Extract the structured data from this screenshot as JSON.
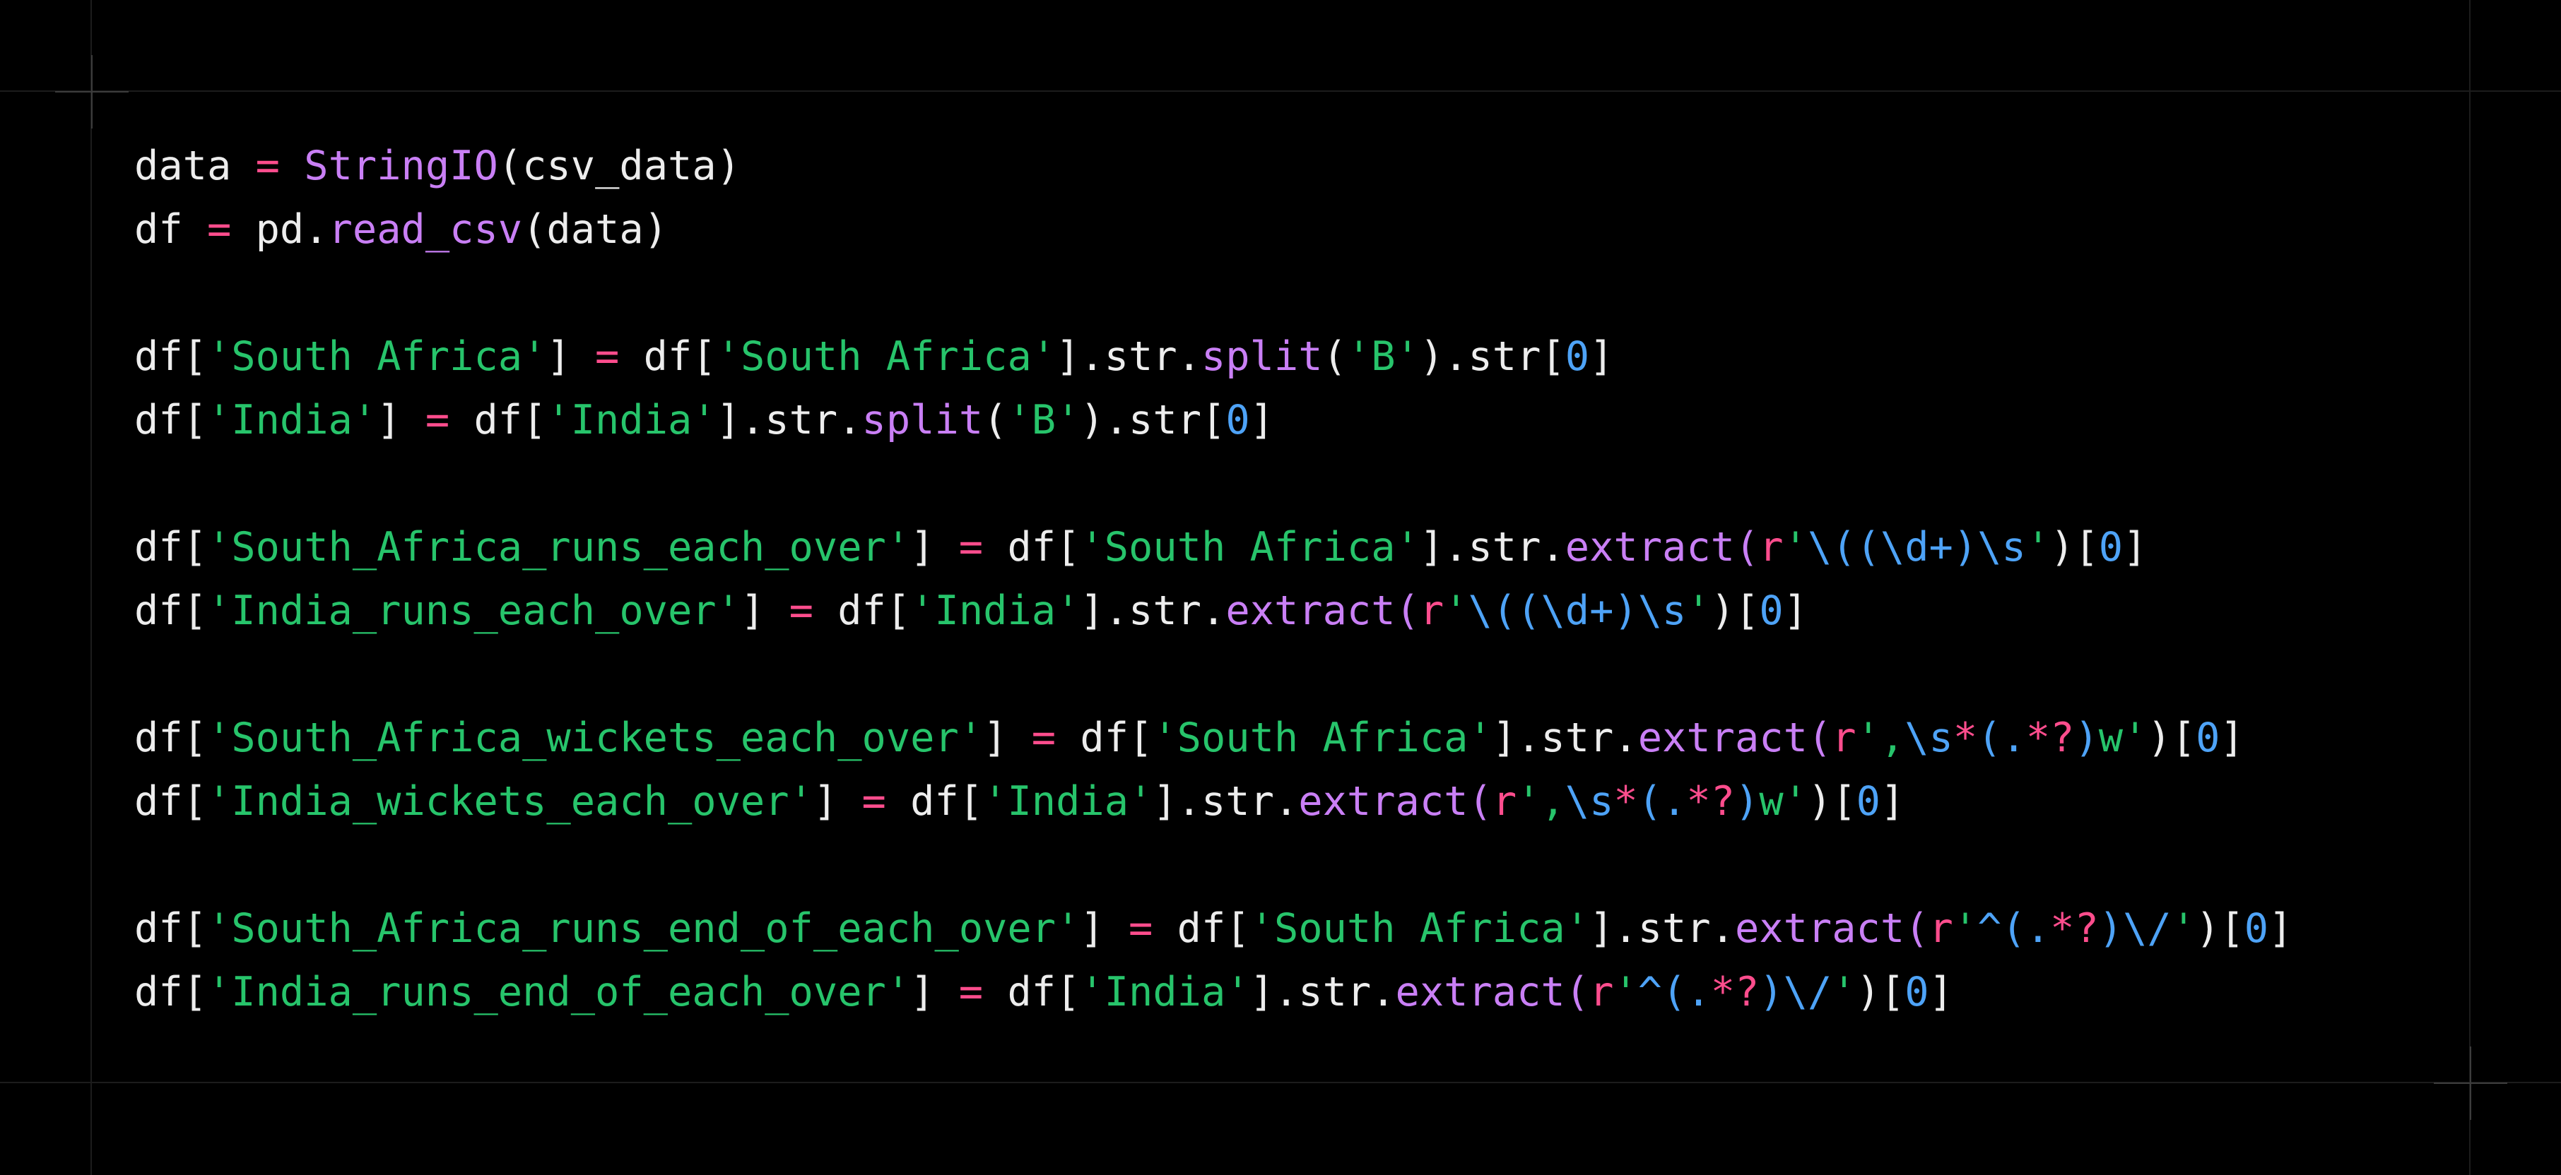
{
  "colors": {
    "background": "#000000",
    "text": "#ededed",
    "operator": "#ff4d8d",
    "function": "#c97ff5",
    "string": "#27c46b",
    "number": "#4ea3f7",
    "regex_escape": "#4ea3f7"
  },
  "code_lines": [
    {
      "tokens": [
        {
          "t": "data ",
          "k": "plain"
        },
        {
          "t": "=",
          "k": "op"
        },
        {
          "t": " ",
          "k": "plain"
        },
        {
          "t": "StringIO",
          "k": "fn"
        },
        {
          "t": "(csv_data)",
          "k": "plain"
        }
      ]
    },
    {
      "tokens": [
        {
          "t": "df ",
          "k": "plain"
        },
        {
          "t": "=",
          "k": "op"
        },
        {
          "t": " pd.",
          "k": "plain"
        },
        {
          "t": "read_csv",
          "k": "fn"
        },
        {
          "t": "(data)",
          "k": "plain"
        }
      ]
    },
    {
      "blank": true
    },
    {
      "tokens": [
        {
          "t": "df[",
          "k": "plain"
        },
        {
          "t": "'South Africa'",
          "k": "str"
        },
        {
          "t": "] ",
          "k": "plain"
        },
        {
          "t": "=",
          "k": "op"
        },
        {
          "t": " df[",
          "k": "plain"
        },
        {
          "t": "'South Africa'",
          "k": "str"
        },
        {
          "t": "].str.",
          "k": "plain"
        },
        {
          "t": "split",
          "k": "fn"
        },
        {
          "t": "(",
          "k": "plain"
        },
        {
          "t": "'B'",
          "k": "str"
        },
        {
          "t": ").str[",
          "k": "plain"
        },
        {
          "t": "0",
          "k": "num"
        },
        {
          "t": "]",
          "k": "plain"
        }
      ]
    },
    {
      "tokens": [
        {
          "t": "df[",
          "k": "plain"
        },
        {
          "t": "'India'",
          "k": "str"
        },
        {
          "t": "] ",
          "k": "plain"
        },
        {
          "t": "=",
          "k": "op"
        },
        {
          "t": " df[",
          "k": "plain"
        },
        {
          "t": "'India'",
          "k": "str"
        },
        {
          "t": "].str.",
          "k": "plain"
        },
        {
          "t": "split",
          "k": "fn"
        },
        {
          "t": "(",
          "k": "plain"
        },
        {
          "t": "'B'",
          "k": "str"
        },
        {
          "t": ").str[",
          "k": "plain"
        },
        {
          "t": "0",
          "k": "num"
        },
        {
          "t": "]",
          "k": "plain"
        }
      ]
    },
    {
      "blank": true
    },
    {
      "tokens": [
        {
          "t": "df[",
          "k": "plain"
        },
        {
          "t": "'South_Africa_runs_each_over'",
          "k": "str"
        },
        {
          "t": "] ",
          "k": "plain"
        },
        {
          "t": "=",
          "k": "op"
        },
        {
          "t": " df[",
          "k": "plain"
        },
        {
          "t": "'South Africa'",
          "k": "str"
        },
        {
          "t": "].str.",
          "k": "plain"
        },
        {
          "t": "extract",
          "k": "fn"
        },
        {
          "t": "(",
          "k": "fn"
        },
        {
          "t": "r",
          "k": "rpre"
        },
        {
          "t": "'",
          "k": "str"
        },
        {
          "t": "\\((\\d+)\\s",
          "k": "esc"
        },
        {
          "t": "'",
          "k": "str"
        },
        {
          "t": ")[",
          "k": "plain"
        },
        {
          "t": "0",
          "k": "num"
        },
        {
          "t": "]",
          "k": "plain"
        }
      ]
    },
    {
      "tokens": [
        {
          "t": "df[",
          "k": "plain"
        },
        {
          "t": "'India_runs_each_over'",
          "k": "str"
        },
        {
          "t": "] ",
          "k": "plain"
        },
        {
          "t": "=",
          "k": "op"
        },
        {
          "t": " df[",
          "k": "plain"
        },
        {
          "t": "'India'",
          "k": "str"
        },
        {
          "t": "].str.",
          "k": "plain"
        },
        {
          "t": "extract",
          "k": "fn"
        },
        {
          "t": "(",
          "k": "fn"
        },
        {
          "t": "r",
          "k": "rpre"
        },
        {
          "t": "'",
          "k": "str"
        },
        {
          "t": "\\((\\d+)\\s",
          "k": "esc"
        },
        {
          "t": "'",
          "k": "str"
        },
        {
          "t": ")[",
          "k": "plain"
        },
        {
          "t": "0",
          "k": "num"
        },
        {
          "t": "]",
          "k": "plain"
        }
      ]
    },
    {
      "blank": true
    },
    {
      "tokens": [
        {
          "t": "df[",
          "k": "plain"
        },
        {
          "t": "'South_Africa_wickets_each_over'",
          "k": "str"
        },
        {
          "t": "] ",
          "k": "plain"
        },
        {
          "t": "=",
          "k": "op"
        },
        {
          "t": " df[",
          "k": "plain"
        },
        {
          "t": "'South Africa'",
          "k": "str"
        },
        {
          "t": "].str.",
          "k": "plain"
        },
        {
          "t": "extract",
          "k": "fn"
        },
        {
          "t": "(",
          "k": "fn"
        },
        {
          "t": "r",
          "k": "rpre"
        },
        {
          "t": "',",
          "k": "str"
        },
        {
          "t": "\\s",
          "k": "esc"
        },
        {
          "t": "*",
          "k": "op"
        },
        {
          "t": "(.",
          "k": "esc"
        },
        {
          "t": "*?",
          "k": "op"
        },
        {
          "t": ")",
          "k": "esc"
        },
        {
          "t": "w'",
          "k": "str"
        },
        {
          "t": ")[",
          "k": "plain"
        },
        {
          "t": "0",
          "k": "num"
        },
        {
          "t": "]",
          "k": "plain"
        }
      ]
    },
    {
      "tokens": [
        {
          "t": "df[",
          "k": "plain"
        },
        {
          "t": "'India_wickets_each_over'",
          "k": "str"
        },
        {
          "t": "] ",
          "k": "plain"
        },
        {
          "t": "=",
          "k": "op"
        },
        {
          "t": " df[",
          "k": "plain"
        },
        {
          "t": "'India'",
          "k": "str"
        },
        {
          "t": "].str.",
          "k": "plain"
        },
        {
          "t": "extract",
          "k": "fn"
        },
        {
          "t": "(",
          "k": "fn"
        },
        {
          "t": "r",
          "k": "rpre"
        },
        {
          "t": "',",
          "k": "str"
        },
        {
          "t": "\\s",
          "k": "esc"
        },
        {
          "t": "*",
          "k": "op"
        },
        {
          "t": "(.",
          "k": "esc"
        },
        {
          "t": "*?",
          "k": "op"
        },
        {
          "t": ")",
          "k": "esc"
        },
        {
          "t": "w'",
          "k": "str"
        },
        {
          "t": ")[",
          "k": "plain"
        },
        {
          "t": "0",
          "k": "num"
        },
        {
          "t": "]",
          "k": "plain"
        }
      ]
    },
    {
      "blank": true
    },
    {
      "tokens": [
        {
          "t": "df[",
          "k": "plain"
        },
        {
          "t": "'South_Africa_runs_end_of_each_over'",
          "k": "str"
        },
        {
          "t": "] ",
          "k": "plain"
        },
        {
          "t": "=",
          "k": "op"
        },
        {
          "t": " df[",
          "k": "plain"
        },
        {
          "t": "'South Africa'",
          "k": "str"
        },
        {
          "t": "].str.",
          "k": "plain"
        },
        {
          "t": "extract",
          "k": "fn"
        },
        {
          "t": "(",
          "k": "fn"
        },
        {
          "t": "r",
          "k": "rpre"
        },
        {
          "t": "'",
          "k": "str"
        },
        {
          "t": "^(.",
          "k": "esc"
        },
        {
          "t": "*?",
          "k": "op"
        },
        {
          "t": ")\\/",
          "k": "esc"
        },
        {
          "t": "'",
          "k": "str"
        },
        {
          "t": ")[",
          "k": "plain"
        },
        {
          "t": "0",
          "k": "num"
        },
        {
          "t": "]",
          "k": "plain"
        }
      ]
    },
    {
      "tokens": [
        {
          "t": "df[",
          "k": "plain"
        },
        {
          "t": "'India_runs_end_of_each_over'",
          "k": "str"
        },
        {
          "t": "] ",
          "k": "plain"
        },
        {
          "t": "=",
          "k": "op"
        },
        {
          "t": " df[",
          "k": "plain"
        },
        {
          "t": "'India'",
          "k": "str"
        },
        {
          "t": "].str.",
          "k": "plain"
        },
        {
          "t": "extract",
          "k": "fn"
        },
        {
          "t": "(",
          "k": "fn"
        },
        {
          "t": "r",
          "k": "rpre"
        },
        {
          "t": "'",
          "k": "str"
        },
        {
          "t": "^(.",
          "k": "esc"
        },
        {
          "t": "*?",
          "k": "op"
        },
        {
          "t": ")\\/",
          "k": "esc"
        },
        {
          "t": "'",
          "k": "str"
        },
        {
          "t": ")[",
          "k": "plain"
        },
        {
          "t": "0",
          "k": "num"
        },
        {
          "t": "]",
          "k": "plain"
        }
      ]
    }
  ]
}
